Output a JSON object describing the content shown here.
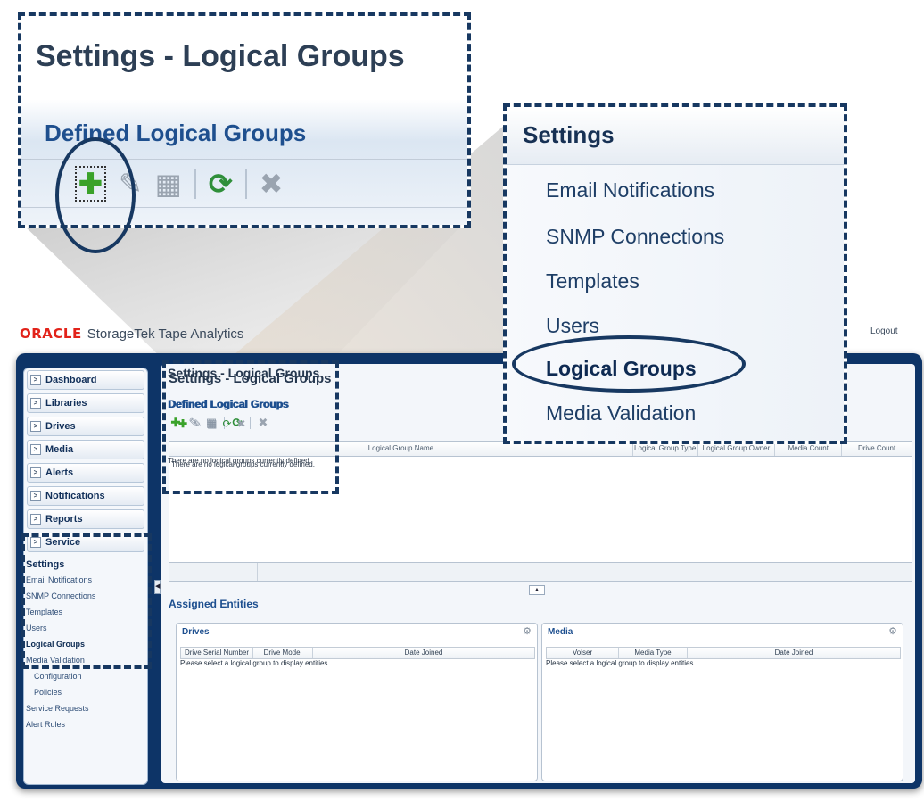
{
  "header": {
    "oracle_logo": "ORACLE",
    "product_name": "StorageTek Tape Analytics",
    "logout": "Logout"
  },
  "sidebar": {
    "items": [
      {
        "label": "Dashboard"
      },
      {
        "label": "Libraries"
      },
      {
        "label": "Drives"
      },
      {
        "label": "Media"
      },
      {
        "label": "Alerts"
      },
      {
        "label": "Notifications"
      },
      {
        "label": "Reports"
      },
      {
        "label": "Service"
      }
    ],
    "settings": {
      "title": "Settings",
      "items": [
        "Email Notifications",
        "SNMP Connections",
        "Templates",
        "Users",
        "Logical Groups",
        "Media Validation",
        "Configuration",
        "Policies",
        "Service Requests",
        "Alert Rules"
      ]
    }
  },
  "main": {
    "title": "Settings - Logical Groups",
    "defined_title": "Defined Logical Groups",
    "grid_columns": [
      "Logical Group Name",
      "Logical Group Type",
      "Logical Group Owner",
      "Media Count",
      "Drive Count"
    ],
    "grid_empty": "There are no logical groups currently defined.",
    "assigned_title": "Assigned Entities",
    "drives": {
      "title": "Drives",
      "columns": [
        "Drive Serial Number",
        "Drive Model",
        "Date Joined"
      ],
      "empty": "Please select a logical group to display entities"
    },
    "media": {
      "title": "Media",
      "columns": [
        "Volser",
        "Media Type",
        "Date Joined"
      ],
      "empty": "Please select a logical group to display entities"
    }
  },
  "callout_big": {
    "title": "Settings - Logical Groups",
    "subtitle": "Defined Logical Groups"
  },
  "callout_menu": {
    "title": "Settings",
    "items": [
      "Email Notifications",
      "SNMP Connections",
      "Templates",
      "Users",
      "Logical Groups",
      "Media Validation"
    ]
  },
  "icons": {
    "add": "add-icon",
    "edit": "edit-icon",
    "assign": "assign-icon",
    "refresh": "refresh-icon",
    "delete": "delete-icon",
    "collapse": "collapse-icon",
    "export": "export-icon"
  },
  "colors": {
    "frame": "#0d3467",
    "callout_border": "#173861",
    "oracle_red": "#e2231a",
    "add_green": "#3aa22a",
    "refresh_green": "#2f8f3a"
  }
}
